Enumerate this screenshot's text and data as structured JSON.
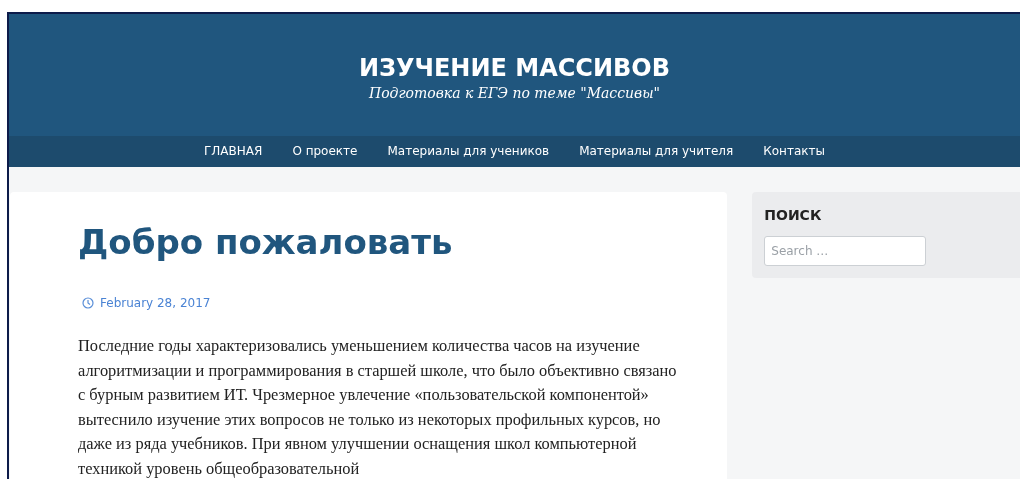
{
  "site": {
    "title": "ИЗУЧЕНИЕ МАССИВОВ",
    "tagline": "Подготовка к ЕГЭ по теме \"Массивы\""
  },
  "nav": [
    {
      "label": "ГЛАВНАЯ"
    },
    {
      "label": "О проекте"
    },
    {
      "label": "Материалы для учеников"
    },
    {
      "label": "Материалы для учителя"
    },
    {
      "label": "Контакты"
    }
  ],
  "post": {
    "title": "Добро пожаловать",
    "date": "February 28, 2017",
    "body": "Последние годы характеризовались уменьшением количества часов на изучение алгоритмизации и программирования в старшей школе, что было объективно связано с бурным развитием ИТ. Чрезмерное увлечение «пользовательской компонентой» вытеснило изучение этих вопросов не только из некоторых профильных курсов, но даже из ряда учебников. При явном улучшении оснащения школ компьютерной техникой уровень общеобразовательной"
  },
  "sidebar": {
    "heading": "ПОИСК",
    "search": {
      "placeholder": "Search …"
    }
  }
}
